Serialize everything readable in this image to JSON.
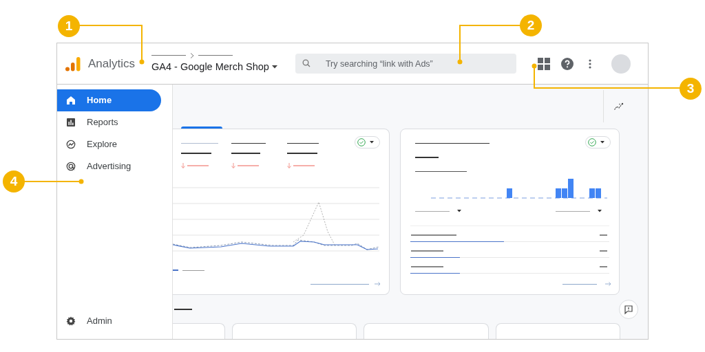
{
  "callouts": [
    {
      "number": "1"
    },
    {
      "number": "2"
    },
    {
      "number": "3"
    },
    {
      "number": "4"
    }
  ],
  "header": {
    "product": "Analytics",
    "property": "GA4 - Google Merch Shop",
    "search": {
      "placeholder": "Try searching “link with Ads”"
    }
  },
  "nav": [
    {
      "label": "Home",
      "kind": "home",
      "selected": true
    },
    {
      "label": "Reports",
      "kind": "reports",
      "selected": false
    },
    {
      "label": "Explore",
      "kind": "explore",
      "selected": false
    },
    {
      "label": "Advertising",
      "kind": "advertising",
      "selected": false
    }
  ],
  "breakdown": [
    {
      "level": 0.47
    },
    {
      "level": 0.25
    },
    {
      "level": 0.25
    }
  ],
  "admin": {
    "label": "Admin"
  }
}
